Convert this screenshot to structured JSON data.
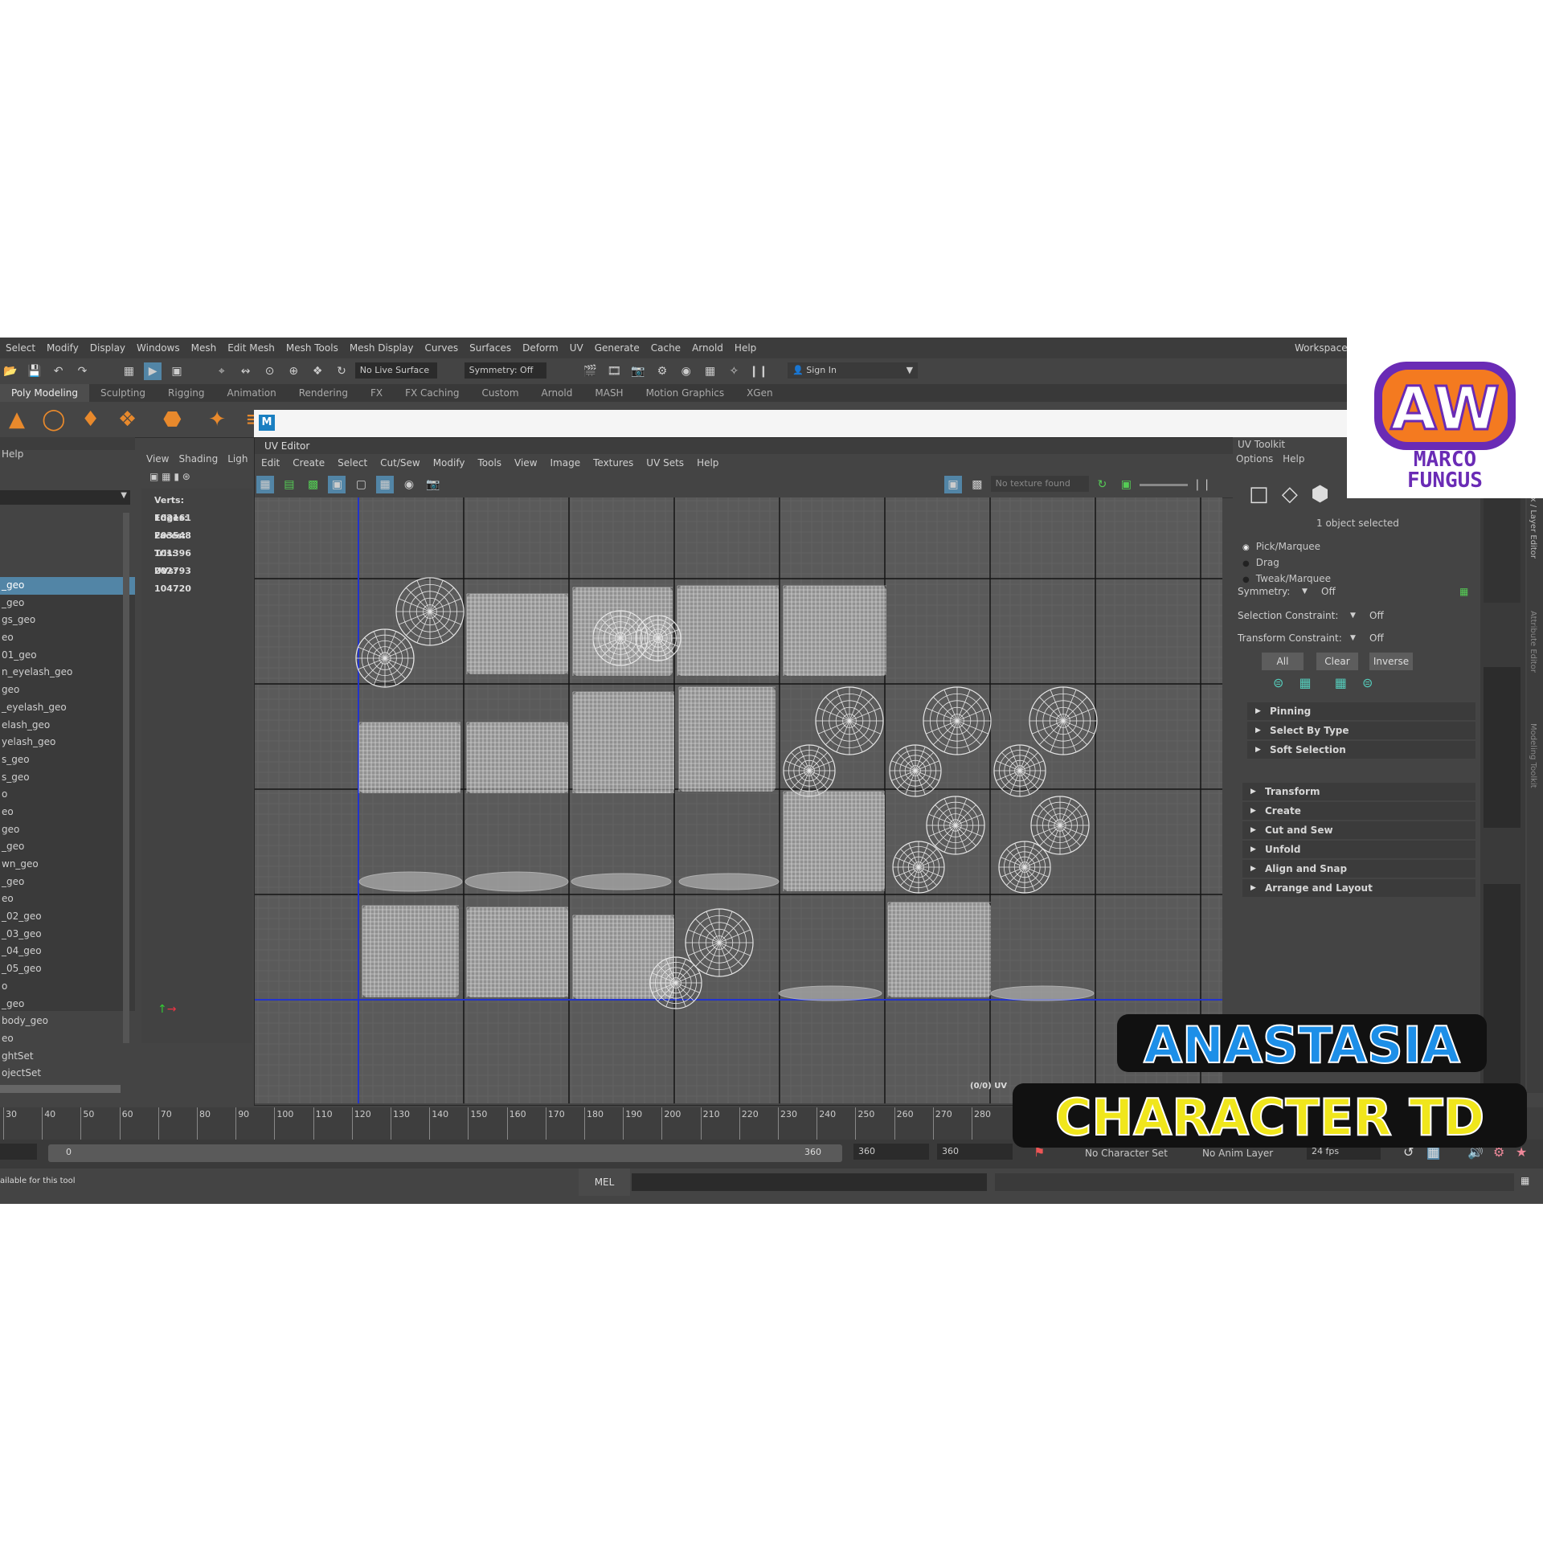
{
  "menubar": [
    "Select",
    "Modify",
    "Display",
    "Windows",
    "Mesh",
    "Edit Mesh",
    "Mesh Tools",
    "Mesh Display",
    "Curves",
    "Surfaces",
    "Deform",
    "UV",
    "Generate",
    "Cache",
    "Arnold",
    "Help"
  ],
  "workspace_label": "Workspace:",
  "status": {
    "live_surface": "No Live Surface",
    "symmetry": "Symmetry: Off",
    "sign_in": "Sign In"
  },
  "shelf_tabs": [
    "Poly Modeling",
    "Sculpting",
    "Rigging",
    "Animation",
    "Rendering",
    "FX",
    "FX Caching",
    "Custom",
    "Arnold",
    "MASH",
    "Motion Graphics",
    "XGen"
  ],
  "outliner": {
    "help": "Help",
    "items": [
      "_geo",
      "_geo",
      "gs_geo",
      "eo",
      "01_geo",
      "n_eyelash_geo",
      "geo",
      "_eyelash_geo",
      "elash_geo",
      "yelash_geo",
      "s_geo",
      "s_geo",
      "o",
      "eo",
      "geo",
      "_geo",
      "wn_geo",
      "_geo",
      "eo",
      "_02_geo",
      "_03_geo",
      "_04_geo",
      "_05_geo",
      "o",
      "_geo",
      "body_geo",
      "eo",
      "ghtSet",
      "ojectSet"
    ]
  },
  "viewport_menu": [
    "View",
    "Shading",
    "Ligh"
  ],
  "hud": [
    {
      "label": "Verts:",
      "value": "102161"
    },
    {
      "label": "Edges:",
      "value": "203548"
    },
    {
      "label": "Faces:",
      "value": "101396"
    },
    {
      "label": "Tris:",
      "value": "202793"
    },
    {
      "label": "UVs:",
      "value": "104720"
    }
  ],
  "uv_editor": {
    "title": "UV Editor",
    "menu": [
      "Edit",
      "Create",
      "Select",
      "Cut/Sew",
      "Modify",
      "Tools",
      "View",
      "Image",
      "Textures",
      "UV Sets",
      "Help"
    ],
    "texture_status": "No texture found",
    "uv_readout": "(0/0) UV"
  },
  "uv_toolkit": {
    "title": "UV Toolkit",
    "menu": [
      "Options",
      "Help"
    ],
    "selected_status": "1 object selected",
    "radios": [
      "Pick/Marquee",
      "Drag",
      "Tweak/Marquee"
    ],
    "symmetry_label": "Symmetry:",
    "symmetry_value": "Off",
    "selection_constraint_label": "Selection Constraint:",
    "selection_constraint_value": "Off",
    "transform_constraint_label": "Transform Constraint:",
    "transform_constraint_value": "Off",
    "buttons": [
      "All",
      "Clear",
      "Inverse"
    ],
    "subsections": [
      "Pinning",
      "Select By Type",
      "Soft Selection"
    ],
    "sections": [
      "Transform",
      "Create",
      "Cut and Sew",
      "Unfold",
      "Align and Snap",
      "Arrange and Layout"
    ]
  },
  "side_tabs": [
    "Box / Layer Editor",
    "Attribute Editor",
    "Modeling Toolkit"
  ],
  "timeline_ticks": [
    "30",
    "40",
    "50",
    "60",
    "70",
    "80",
    "90",
    "100",
    "110",
    "120",
    "130",
    "140",
    "150",
    "160",
    "170",
    "180",
    "190",
    "200",
    "210",
    "220",
    "230",
    "240",
    "250",
    "260",
    "270",
    "280"
  ],
  "range": {
    "start": "0",
    "end_inner": "360",
    "end1": "360",
    "end2": "360",
    "character_set": "No Character Set",
    "anim_layer": "No Anim Layer",
    "fps": "24 fps"
  },
  "command": {
    "help_text": "ailable for this tool",
    "language": "MEL"
  },
  "branding": {
    "logo_letters": "AW",
    "logo_line1": "MARCO",
    "logo_line2": "FUNGUS",
    "title1": "ANASTASIA",
    "title2": "CHARACTER TD",
    "colors": {
      "orange": "#f47a20",
      "purple": "#6a2bb5",
      "blue": "#1d8fe8",
      "yellow": "#f0e61c",
      "black": "#111111"
    }
  }
}
